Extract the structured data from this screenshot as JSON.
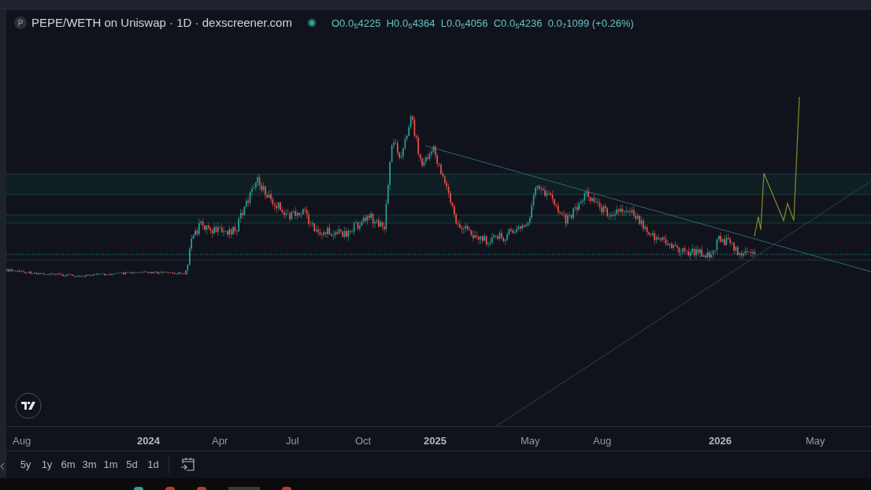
{
  "header": {
    "symbol_initial": "P",
    "title": "PEPE/WETH on Uniswap · 1D · dexscreener.com",
    "ohlc": "O0.0$_{5}$4225  H0.0$_{5}$4364  L0.0$_{5}$4056  C0.0$_{5}$4236  0.0$_{7}$1099 (+0.26%)"
  },
  "time_axis": [
    {
      "label": "Aug",
      "kind": "month"
    },
    {
      "label": "2024",
      "kind": "year"
    },
    {
      "label": "Apr",
      "kind": "month"
    },
    {
      "label": "Jul",
      "kind": "month"
    },
    {
      "label": "Oct",
      "kind": "month"
    },
    {
      "label": "2025",
      "kind": "year"
    },
    {
      "label": "May",
      "kind": "month"
    },
    {
      "label": "Aug",
      "kind": "month"
    },
    {
      "label": "2026",
      "kind": "year"
    },
    {
      "label": "May",
      "kind": "month"
    }
  ],
  "ranges": [
    "5y",
    "1y",
    "6m",
    "3m",
    "1m",
    "5d",
    "1d"
  ]
}
